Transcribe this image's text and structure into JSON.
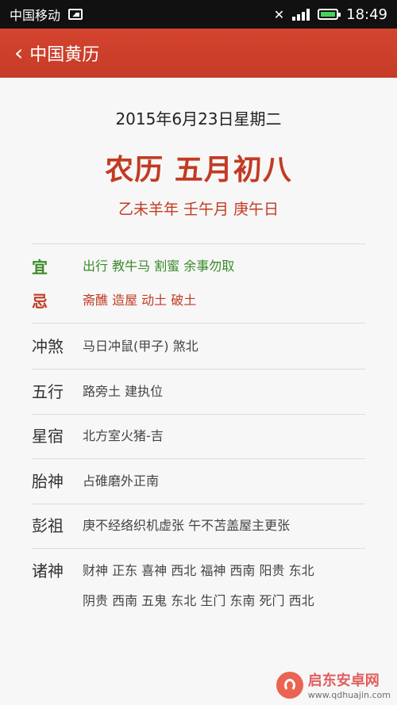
{
  "status_bar": {
    "carrier": "中国移动",
    "time": "18:49",
    "battery_color": "#46d35a"
  },
  "header": {
    "back_icon": "chevron-left-icon",
    "title": "中国黄历",
    "bg_color": "#c53b27"
  },
  "date": {
    "gregorian": "2015年6月23日星期二",
    "lunar": "农历 五月初八",
    "ganzhi": "乙未羊年 壬午月 庚午日"
  },
  "almanac": {
    "yi": {
      "label": "宜",
      "value": "出行 教牛马 割蜜 余事勿取",
      "color": "#3a8a2a"
    },
    "ji": {
      "label": "忌",
      "value": "斋醮 造屋 动土 破土",
      "color": "#c23b22"
    },
    "chongsha": {
      "label": "冲煞",
      "value": "马日冲鼠(甲子) 煞北"
    },
    "wuxing": {
      "label": "五行",
      "value": "路旁土 建执位"
    },
    "xingsu": {
      "label": "星宿",
      "value": "北方室火猪-吉"
    },
    "taishen": {
      "label": "胎神",
      "value": "占碓磨外正南"
    },
    "pengzu": {
      "label": "彭祖",
      "value": "庚不经络织机虚张 午不苫盖屋主更张"
    },
    "zhushen": {
      "label": "诸神",
      "line1": "财神 正东 喜神 西北 福神 西南 阳贵 东北",
      "line2": "阴贵 西南 五鬼 东北 生门 东南 死门 西北"
    }
  },
  "watermark": {
    "name": "启东安卓网",
    "url": "www.qdhuajin.com"
  }
}
